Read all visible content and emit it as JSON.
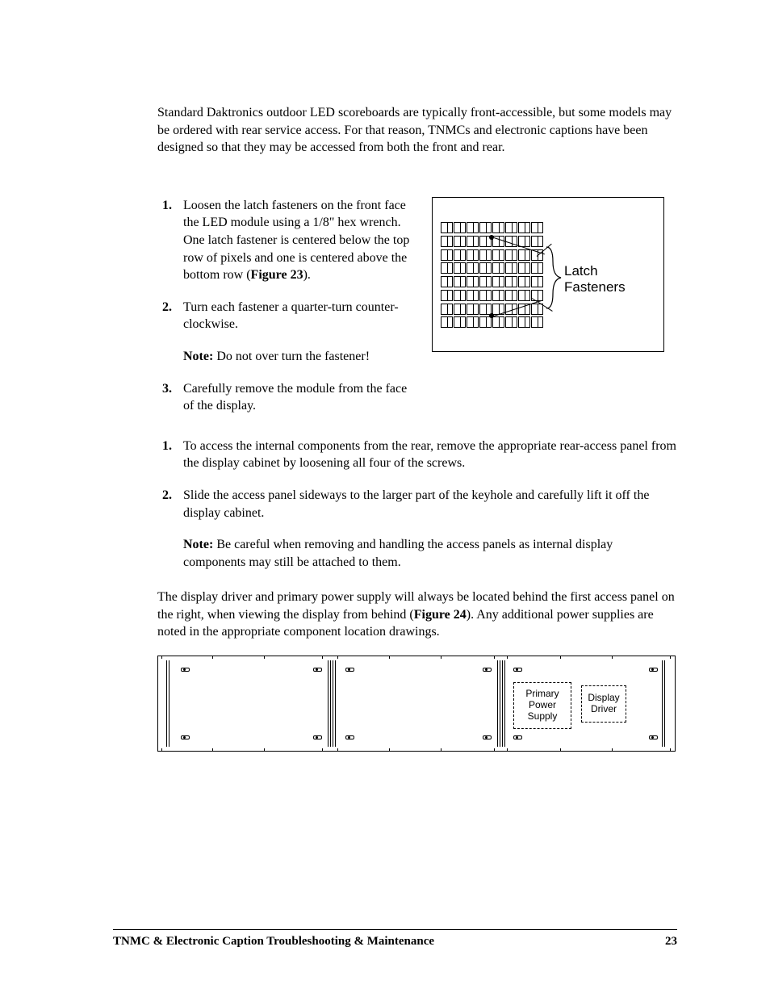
{
  "intro": "Standard Daktronics outdoor LED scoreboards are typically front-accessible, but some models may be ordered with rear service access. For that reason, TNMCs and electronic captions have been designed so that they may be accessed from both the front and rear.",
  "front": {
    "steps": [
      {
        "pre": "Loosen the latch fasteners on the front face the LED module using a 1/8\" hex wrench. One latch fastener is centered below the top row of pixels and one is centered above the bottom row (",
        "figref": "Figure 23",
        "post": ")."
      },
      {
        "text": "Turn each fastener a quarter-turn counter-clockwise.",
        "note_label": "Note:",
        "note_text": " Do not over turn the fastener!"
      },
      {
        "text": "Carefully remove the module from the face of the display."
      }
    ]
  },
  "fig23": {
    "label_line1": "Latch",
    "label_line2": "Fasteners"
  },
  "rear": {
    "steps": [
      {
        "text": "To access the internal components from the rear, remove the appropriate rear-access panel from the display cabinet by loosening all four of the screws."
      },
      {
        "text": "Slide the access panel sideways to the larger part of the keyhole and carefully lift it off the display cabinet.",
        "note_label": "Note:",
        "note_text": " Be careful when removing and handling the access panels as internal display components may still be attached to them."
      }
    ]
  },
  "para2_pre": "The display driver and primary power supply will always be located behind the first access panel on the right, when viewing the display from behind (",
  "para2_figref": "Figure 24",
  "para2_post": "). Any additional power supplies are noted in the appropriate component location drawings.",
  "fig24": {
    "box1": "Primary Power Supply",
    "box2_line1": "Display",
    "box2_line2": "Driver"
  },
  "footer": {
    "title": "TNMC & Electronic Caption Troubleshooting & Maintenance",
    "page": "23"
  }
}
